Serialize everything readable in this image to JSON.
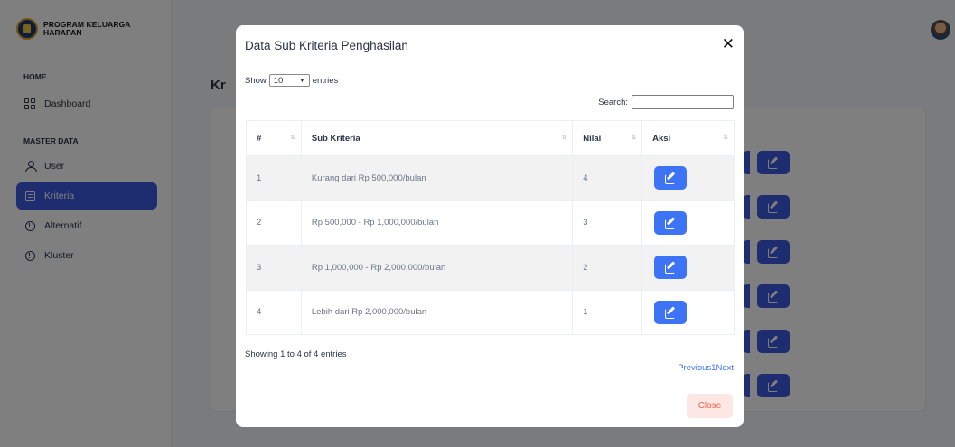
{
  "brand": {
    "line1": "PROGRAM KELUARGA",
    "line2": "HARAPAN"
  },
  "sidebar": {
    "sections": [
      {
        "caption": "HOME"
      },
      {
        "caption": "MASTER DATA"
      }
    ],
    "items": [
      {
        "label": "Dashboard",
        "icon": "dashboard-icon"
      },
      {
        "label": "User",
        "icon": "user-icon"
      },
      {
        "label": "Kriteria",
        "icon": "document-icon",
        "active": true
      },
      {
        "label": "Alternatif",
        "icon": "info-icon"
      },
      {
        "label": "Kluster",
        "icon": "info-icon"
      }
    ]
  },
  "background": {
    "page_title_fragment": "Kr"
  },
  "modal": {
    "title": "Data Sub Kriteria Penghasilan",
    "close_glyph": "✕",
    "show_label": "Show",
    "entries_value": "10",
    "entries_label": "entries",
    "search_label": "Search:",
    "search_value": "",
    "columns": [
      "#",
      "Sub Kriteria",
      "Nilai",
      "Aksi"
    ],
    "rows": [
      {
        "no": "1",
        "sub": "Kurang dari Rp 500,000/bulan",
        "nilai": "4"
      },
      {
        "no": "2",
        "sub": "Rp 500,000 - Rp 1,000,000/bulan",
        "nilai": "3"
      },
      {
        "no": "3",
        "sub": "Rp 1,000,000 - Rp 2,000,000/bulan",
        "nilai": "2"
      },
      {
        "no": "4",
        "sub": "Lebih dari Rp 2,000,000/bulan",
        "nilai": "1"
      }
    ],
    "info": "Showing 1 to 4 of 4 entries",
    "pager": {
      "prev": "Previous",
      "page": "1",
      "next": "Next"
    },
    "close_label": "Close"
  },
  "colors": {
    "accent": "#3d5be0",
    "edit_button": "#3d73f5",
    "close_text": "#f0624d",
    "close_bg": "#fde7e4"
  }
}
